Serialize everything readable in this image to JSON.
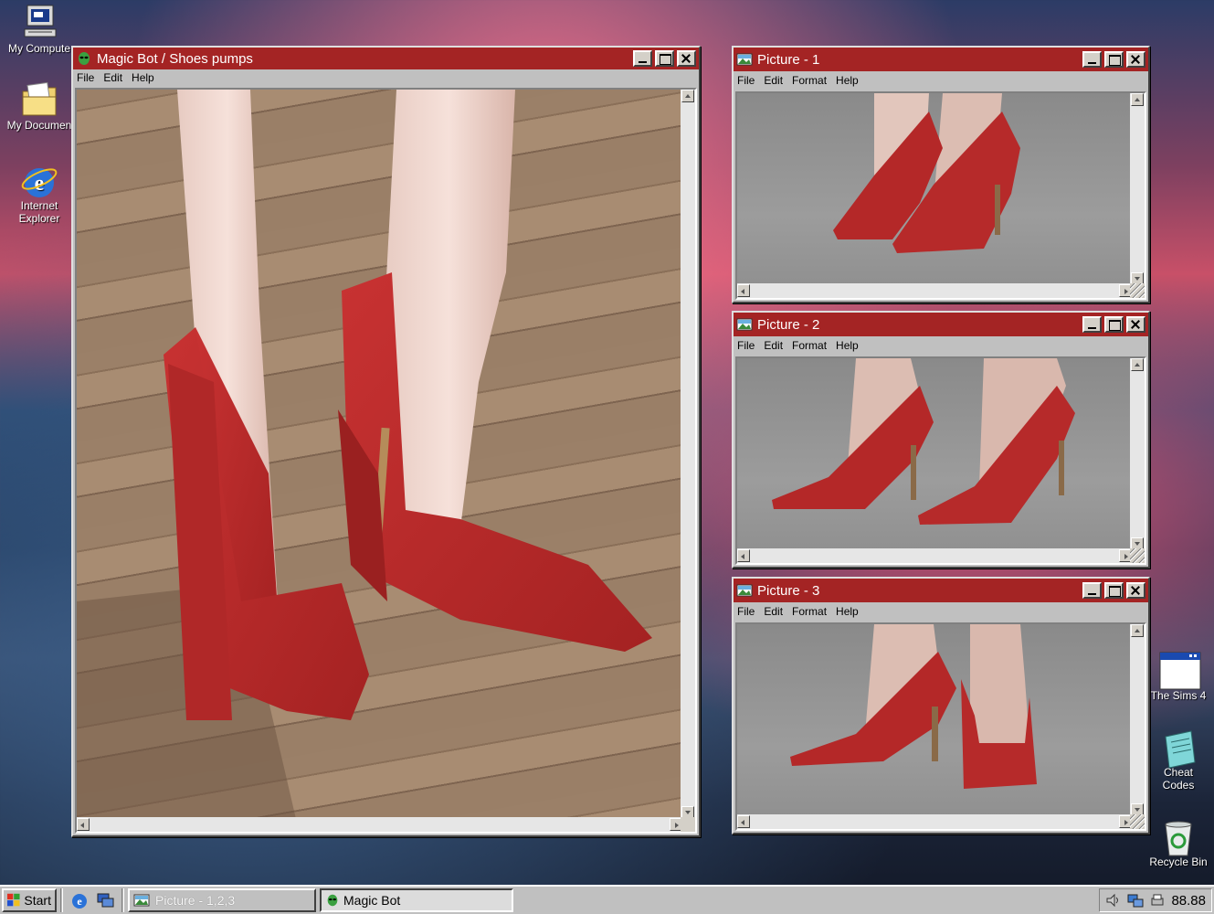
{
  "desktop": {
    "icons_left": [
      {
        "label": "My Compute"
      },
      {
        "label": "My Documen"
      },
      {
        "label": "Internet\nExplorer"
      }
    ],
    "icons_right": [
      {
        "label": "The Sims 4"
      },
      {
        "label": "Cheat\nCodes"
      },
      {
        "label": "Recycle Bin"
      }
    ]
  },
  "main_window": {
    "title": "Magic Bot / Shoes pumps",
    "menu": [
      "File",
      "Edit",
      "Help"
    ]
  },
  "picture_windows": [
    {
      "title": "Picture - 1",
      "menu": [
        "File",
        "Edit",
        "Format",
        "Help"
      ]
    },
    {
      "title": "Picture - 2",
      "menu": [
        "File",
        "Edit",
        "Format",
        "Help"
      ]
    },
    {
      "title": "Picture - 3",
      "menu": [
        "File",
        "Edit",
        "Format",
        "Help"
      ]
    }
  ],
  "taskbar": {
    "start_label": "Start",
    "tasks": [
      {
        "label": "Picture - 1,2,3",
        "active": false
      },
      {
        "label": "Magic Bot",
        "active": true
      }
    ],
    "clock": "88.88"
  },
  "colors": {
    "titlebar": "#a42424",
    "shoe_red": "#b42828"
  }
}
